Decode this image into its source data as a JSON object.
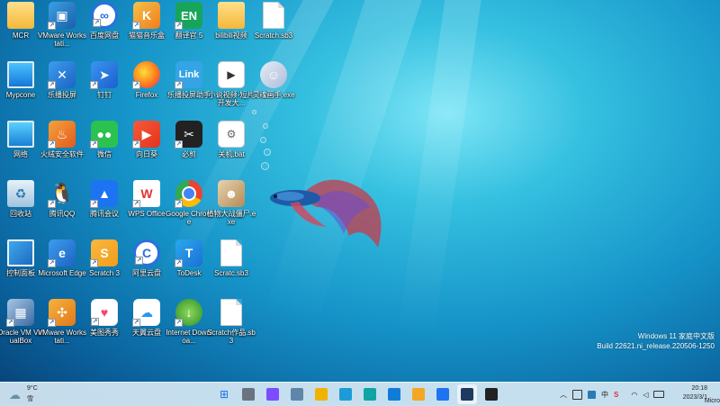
{
  "desktop": {
    "icons": [
      {
        "label": "MCR",
        "icon": "folder-icon",
        "style": "ic-folder",
        "glyph": "",
        "shortcut": false
      },
      {
        "label": "VMware Workstati...",
        "icon": "vmware-icon",
        "style": "ic-vmware-blue",
        "glyph": "▣",
        "shortcut": true
      },
      {
        "label": "百度网盘",
        "icon": "baidu-netdisk-icon",
        "style": "ic-baidu",
        "glyph": "∞",
        "shortcut": true
      },
      {
        "label": "猫猫音乐盒",
        "icon": "music-box-icon",
        "style": "ic-orange-star",
        "glyph": "K",
        "shortcut": true
      },
      {
        "label": "翻译官 5",
        "icon": "translator-icon",
        "style": "ic-en",
        "glyph": "EN",
        "shortcut": true
      },
      {
        "label": "bilibili视频",
        "icon": "folder-icon",
        "style": "ic-folder",
        "glyph": "",
        "shortcut": false
      },
      {
        "label": "Scratch.sb3",
        "icon": "file-icon",
        "style": "ic-file",
        "glyph": "",
        "shortcut": false
      },
      {
        "label": "Mypcone",
        "icon": "computer-icon",
        "style": "ic-monitor",
        "glyph": "",
        "shortcut": false
      },
      {
        "label": "乐播投屏",
        "icon": "screencast-icon",
        "style": "ic-shield-blue",
        "glyph": "✕",
        "shortcut": true
      },
      {
        "label": "钉钉",
        "icon": "dingtalk-icon",
        "style": "ic-arrow-blue",
        "glyph": "➤",
        "shortcut": true
      },
      {
        "label": "Firefox",
        "icon": "firefox-icon",
        "style": "ic-firefox",
        "glyph": "",
        "shortcut": true
      },
      {
        "label": "乐播投屏助手",
        "icon": "link-icon",
        "style": "ic-link",
        "glyph": "Link",
        "shortcut": true
      },
      {
        "label": "小说视频-短片开发大...",
        "icon": "video-file-icon",
        "style": "ic-video",
        "glyph": "▶",
        "shortcut": false
      },
      {
        "label": "灵魂画手.exe",
        "icon": "anime-exe-icon",
        "style": "ic-anime",
        "glyph": "☺",
        "shortcut": false
      },
      {
        "label": "网络",
        "icon": "network-icon",
        "style": "ic-network",
        "glyph": "",
        "shortcut": false
      },
      {
        "label": "火绒安全软件",
        "icon": "huorong-icon",
        "style": "ic-fire",
        "glyph": "♨",
        "shortcut": true
      },
      {
        "label": "微信",
        "icon": "wechat-icon",
        "style": "ic-wechat",
        "glyph": "●●",
        "shortcut": true
      },
      {
        "label": "向日葵",
        "icon": "sunlogin-icon",
        "style": "ic-play",
        "glyph": "▶",
        "shortcut": true
      },
      {
        "label": "必剪",
        "icon": "bijian-icon",
        "style": "ic-dark",
        "glyph": "✂",
        "shortcut": true
      },
      {
        "label": "关机.bat",
        "icon": "bat-file-icon",
        "style": "ic-exe",
        "glyph": "⚙",
        "shortcut": false
      },
      {
        "label": "回收站",
        "icon": "recycle-bin-icon",
        "style": "ic-bin",
        "glyph": "♻",
        "shortcut": false
      },
      {
        "label": "腾讯QQ",
        "icon": "qq-icon",
        "style": "ic-penguin",
        "glyph": "🐧",
        "shortcut": true
      },
      {
        "label": "腾讯会议",
        "icon": "tencent-meeting-icon",
        "style": "ic-meeting",
        "glyph": "▲",
        "shortcut": true
      },
      {
        "label": "WPS Office",
        "icon": "wps-icon",
        "style": "ic-wps",
        "glyph": "W",
        "shortcut": true
      },
      {
        "label": "Google Chrome",
        "icon": "chrome-icon",
        "style": "ic-chrome",
        "glyph": "",
        "shortcut": true
      },
      {
        "label": "植物大战僵尸.exe",
        "icon": "game-exe-icon",
        "style": "ic-game",
        "glyph": "☻",
        "shortcut": false
      },
      {
        "label": "控制面板",
        "icon": "control-panel-icon",
        "style": "ic-control",
        "glyph": "",
        "shortcut": false
      },
      {
        "label": "Microsoft Edge",
        "icon": "edge-icon",
        "style": "ic-shield-blue",
        "glyph": "e",
        "shortcut": true
      },
      {
        "label": "Scratch 3",
        "icon": "scratch-icon",
        "style": "ic-scratch",
        "glyph": "S",
        "shortcut": true
      },
      {
        "label": "阿里云盘",
        "icon": "aliyun-drive-icon",
        "style": "ic-baidu",
        "glyph": "C",
        "shortcut": true
      },
      {
        "label": "ToDesk",
        "icon": "todesk-icon",
        "style": "ic-todesk",
        "glyph": "T",
        "shortcut": true
      },
      {
        "label": "Scratc.sb3",
        "icon": "file-icon",
        "style": "ic-file",
        "glyph": "",
        "shortcut": false
      },
      {
        "label": "Oracle VM VirtualBox",
        "icon": "virtualbox-icon",
        "style": "ic-vbox",
        "glyph": "▦",
        "shortcut": true
      },
      {
        "label": "VMware Workstati...",
        "icon": "vmware-player-icon",
        "style": "ic-vmware-orange",
        "glyph": "✣",
        "shortcut": true
      },
      {
        "label": "美图秀秀",
        "icon": "meitu-icon",
        "style": "ic-meitu",
        "glyph": "♥",
        "shortcut": true
      },
      {
        "label": "天翼云盘",
        "icon": "tianyi-cloud-icon",
        "style": "ic-tianyi",
        "glyph": "☁",
        "shortcut": true
      },
      {
        "label": "Internet Downloa...",
        "icon": "idm-icon",
        "style": "ic-idm",
        "glyph": "↓",
        "shortcut": true
      },
      {
        "label": "Scratch作品.sb3",
        "icon": "file-icon",
        "style": "ic-file",
        "glyph": "",
        "shortcut": false
      }
    ]
  },
  "watermark": {
    "line1": "Windows 11 家庭中文版",
    "line2": "Build 22621.ni_release.220506-1250"
  },
  "taskbar": {
    "weather": {
      "temp": "9°C",
      "condition": "雪"
    },
    "apps": [
      {
        "name": "start-button",
        "glyph": "⊞",
        "color": "#1a73e8",
        "active": false
      },
      {
        "name": "taskbar-app-1",
        "glyph": "",
        "color": "#6b7280",
        "active": false
      },
      {
        "name": "taskbar-app-2",
        "glyph": "",
        "color": "#7c4dff",
        "active": false
      },
      {
        "name": "taskbar-app-3",
        "glyph": "",
        "color": "#5f86a8",
        "active": false
      },
      {
        "name": "taskbar-app-4",
        "glyph": "",
        "color": "#f0b400",
        "active": false
      },
      {
        "name": "taskbar-app-5",
        "glyph": "",
        "color": "#1d9bd8",
        "active": false
      },
      {
        "name": "taskbar-edge",
        "glyph": "",
        "color": "#0ea5a2",
        "active": false
      },
      {
        "name": "taskbar-app-7",
        "glyph": "",
        "color": "#0f7dd8",
        "active": false
      },
      {
        "name": "taskbar-app-8",
        "glyph": "",
        "color": "#f5a623",
        "active": false
      },
      {
        "name": "taskbar-app-9",
        "glyph": "",
        "color": "#1d74f2",
        "active": false
      },
      {
        "name": "taskbar-app-10",
        "glyph": "",
        "color": "#1e3a5f",
        "active": true
      },
      {
        "name": "taskbar-app-11",
        "glyph": "",
        "color": "#222222",
        "active": false
      }
    ],
    "tray": {
      "ime": "中",
      "antivirus": "S"
    },
    "clock": {
      "time": "20:18",
      "date": "2023/3/1"
    },
    "corner": "Micro"
  }
}
